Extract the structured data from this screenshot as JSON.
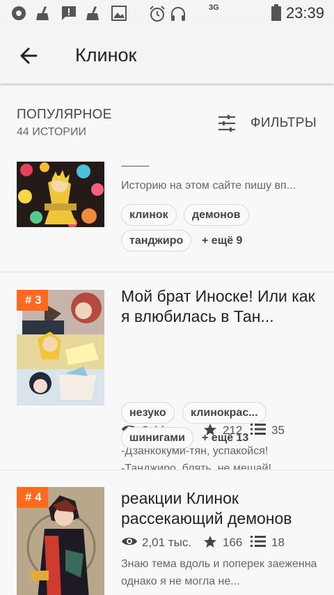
{
  "status_bar": {
    "time": "23:39",
    "network": "3G",
    "icons": [
      "record-icon",
      "broom-icon",
      "message-alert-icon",
      "broom-icon",
      "image-icon",
      "alarm-icon",
      "headset-icon",
      "battery-icon"
    ]
  },
  "app_bar": {
    "title": "Клинок",
    "back_icon": "arrow-left-icon"
  },
  "section": {
    "title": "ПОПУЛЯРНОЕ",
    "count": "44 ИСТОРИИ",
    "filters_label": "ФИЛЬТРЫ",
    "filters_icon": "sliders-icon"
  },
  "stories": [
    {
      "title": "------------",
      "description": "Историю на этом сайте пишу вп...",
      "tags": [
        "клинок",
        "демонов",
        "танджиро"
      ],
      "more_tags": "+ ещё 9"
    },
    {
      "rank": "# 3",
      "title": "Мой брат Иноске! Или как я влюбилась в Тан...",
      "views": "2,44 тыс.",
      "votes": "212",
      "parts": "35",
      "description": "-Дзанкокуми-тян, успакойся!\n-Танджиро, блять, не мешай!...",
      "tags": [
        "незуко",
        "клинокрас...",
        "шинигами"
      ],
      "more_tags": "+ ещё 13"
    },
    {
      "rank": "# 4",
      "title": "реакции Клинок рассекающий демонов",
      "views": "2,01 тыс.",
      "votes": "166",
      "parts": "18",
      "description": "Знаю тема вдоль и поперек заеженна  однако я не могла не..."
    }
  ],
  "colors": {
    "rank_badge": "#ff6a1e",
    "background": "#f8f8f8",
    "text_primary": "#222222",
    "text_secondary": "#666666"
  }
}
